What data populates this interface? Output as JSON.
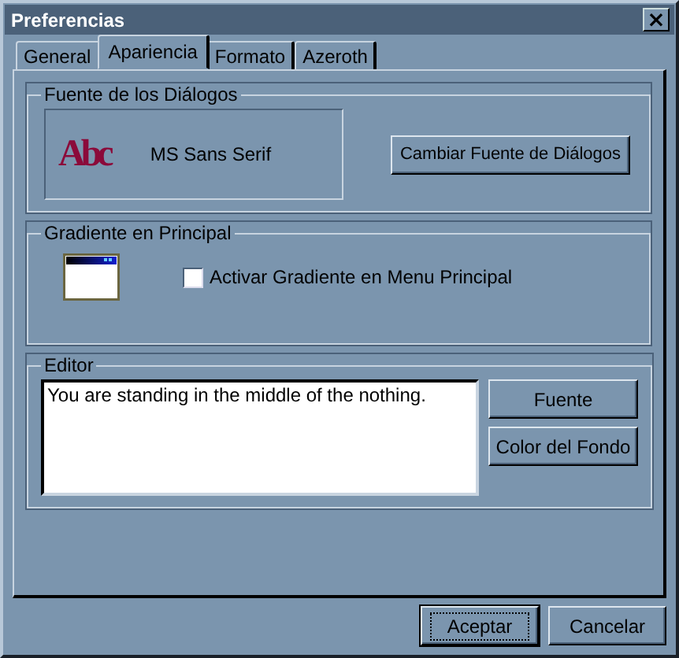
{
  "window": {
    "title": "Preferencias",
    "close": "×"
  },
  "tabs": [
    {
      "label": "General",
      "selected": false
    },
    {
      "label": "Apariencia",
      "selected": true
    },
    {
      "label": "Formato",
      "selected": false
    },
    {
      "label": "Azeroth",
      "selected": false
    }
  ],
  "font_group": {
    "title": "Fuente de los Diálogos",
    "sample_glyphs": "Abc",
    "font_name": "MS Sans Serif",
    "button": "Cambiar Fuente de Diálogos"
  },
  "gradient_group": {
    "title": "Gradiente en Principal",
    "checkbox": {
      "label": "Activar Gradiente en Menu Principal",
      "checked": false
    }
  },
  "editor_group": {
    "title": "Editor",
    "text": "You are standing in the middle of the nothing.",
    "buttons": [
      "Fuente",
      "Color del Fondo"
    ]
  },
  "buttons": [
    {
      "label": "Aceptar",
      "default": true
    },
    {
      "label": "Cancelar",
      "default": false
    }
  ]
}
